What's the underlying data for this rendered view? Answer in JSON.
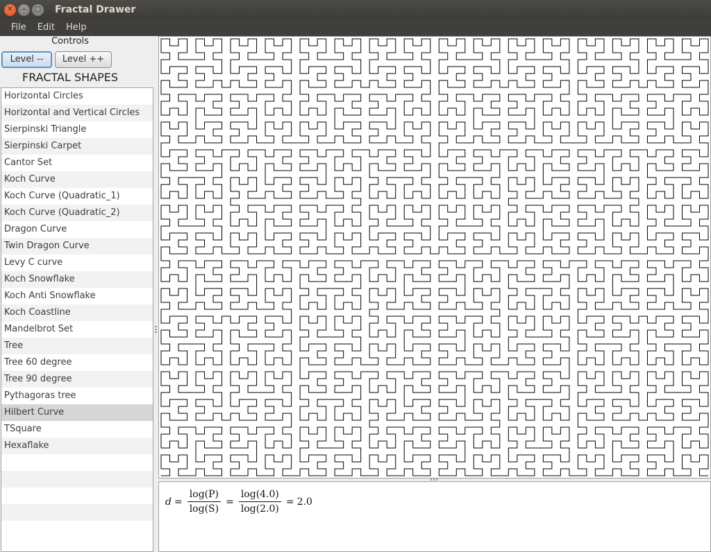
{
  "window": {
    "title": "Fractal Drawer"
  },
  "menu": [
    "File",
    "Edit",
    "Help"
  ],
  "controls": {
    "label": "Controls",
    "level_down": "Level --",
    "level_up": "Level ++"
  },
  "shapes": {
    "title": "FRACTAL SHAPES",
    "items": [
      "Horizontal Circles",
      "Horizontal and Vertical Circles",
      "Sierpinski Triangle",
      "Sierpinski Carpet",
      "Cantor Set",
      "Koch Curve",
      "Koch Curve (Quadratic_1)",
      "Koch Curve (Quadratic_2)",
      "Dragon Curve",
      "Twin Dragon Curve",
      "Levy C curve",
      "Koch Snowflake",
      "Koch Anti Snowflake",
      "Koch Coastline",
      "Mandelbrot Set",
      "Tree",
      "Tree 60 degree",
      "Tree 90 degree",
      "Pythagoras tree",
      "Hilbert Curve",
      "TSquare",
      "Hexaflake"
    ],
    "selected": "Hilbert Curve"
  },
  "canvas": {
    "fractal": "Hilbert Curve",
    "level": 6,
    "stroke_color": "#000000"
  },
  "formula": {
    "lhs": "d",
    "num1": "log(P)",
    "den1": "log(S)",
    "num2": "log(4.0)",
    "den2": "log(2.0)",
    "result": "2.0"
  }
}
